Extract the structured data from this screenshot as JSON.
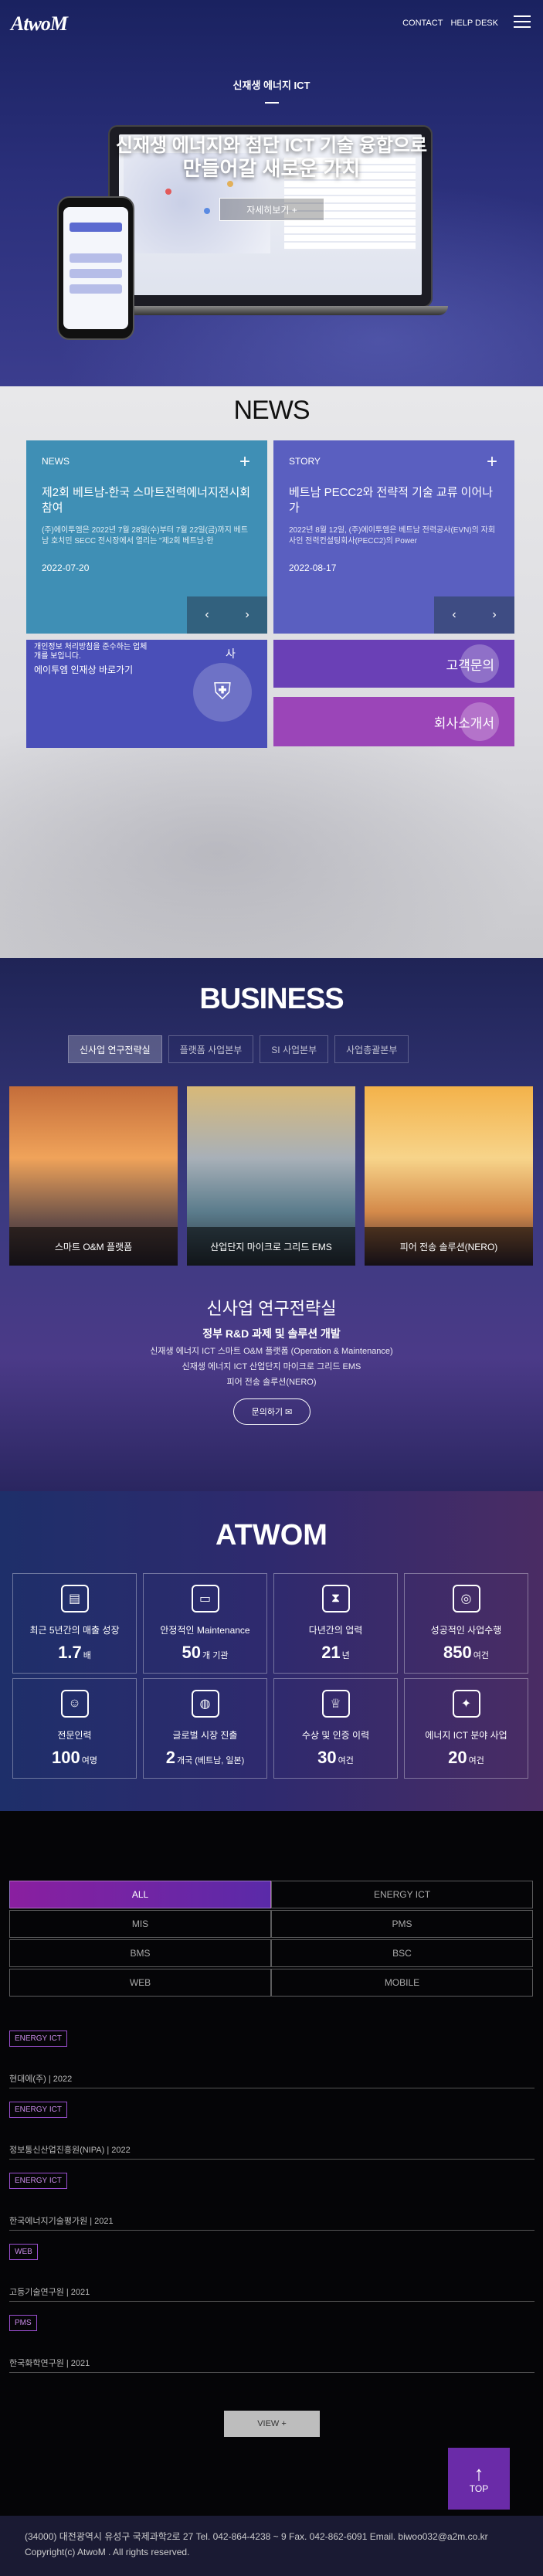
{
  "header": {
    "logo": "AtwoM",
    "nav": [
      "CONTACT",
      "HELP DESK"
    ]
  },
  "hero": {
    "subtitle": "신재생 에너지 ICT",
    "title_line1": "신재생 에너지와 첨단 ICT 기술 융합으로",
    "title_line2": "만들어갈 새로운 가치",
    "button": "자세히보기 +"
  },
  "news": {
    "title": "NEWS",
    "cards": [
      {
        "tag": "NEWS",
        "title": "제2회 베트남-한국 스마트전력에너지전시회 참여",
        "desc": "(주)에이투엠은 2022년 7월 28일(수)부터 7월 22일(금)까지 베트남 호치민 SECC 전시장에서 열리는 \"제2회 베트남-한",
        "date": "2022-07-20"
      },
      {
        "tag": "STORY",
        "title": "베트남 PECC2와 전략적 기술 교류 이어나가",
        "desc": "2022년 8월 12일, (주)에이투엠은 베트남 전력공사(EVN)의 자회사인 전력컨설팅회사(PECC2)의 Power",
        "date": "2022-08-17"
      }
    ],
    "arrows": [
      "‹",
      "›"
    ],
    "popup": {
      "text": "개인정보 처리방침을 준수하는 업체\n개를 보입니다.",
      "link": "에이투엠 인재상 바로가기",
      "tail": "사"
    },
    "contact": "고객문의",
    "brochure": "회사소개서"
  },
  "business": {
    "title": "BUSINESS",
    "tabs": [
      "신사업 연구전략실",
      "플랫폼 사업본부",
      "SI 사업본부",
      "사업총괄본부"
    ],
    "cards": [
      "스마트 O&M 플랫폼",
      "산업단지 마이크로 그리드 EMS",
      "피어 전송 솔루션(NERO)"
    ],
    "heading": "신사업 연구전략실",
    "subheading": "정부 R&D 과제 및 솔루션 개발",
    "lines": [
      "신재생 에너지 ICT 스마트 O&M 플랫폼 (Operation & Maintenance)",
      "신재생 에너지 ICT 산업단지 마이크로 그리드 EMS",
      "피어 전송 솔루션(NERO)"
    ],
    "button": "문의하기 ✉"
  },
  "atwom": {
    "title": "ATWOM",
    "stats": [
      {
        "icon": "chart-icon",
        "label": "최근 5년간의 매출 성장",
        "value": "1.7",
        "unit": "배"
      },
      {
        "icon": "monitor-icon",
        "label": "안정적인 Maintenance",
        "value": "50",
        "unit": "개 기관"
      },
      {
        "icon": "hourglass-icon",
        "label": "다년간의 업력",
        "value": "21",
        "unit": "년"
      },
      {
        "icon": "target-icon",
        "label": "성공적인 사업수행",
        "value": "850",
        "unit": "여건"
      },
      {
        "icon": "people-icon",
        "label": "전문인력",
        "value": "100",
        "unit": "여명"
      },
      {
        "icon": "globe-icon",
        "label": "글로벌 시장 진출",
        "value": "2",
        "unit": "개국 (베트남, 일본)"
      },
      {
        "icon": "trophy-icon",
        "label": "수상 및 인증 이력",
        "value": "30",
        "unit": "여건"
      },
      {
        "icon": "lightbulb-icon",
        "label": "에너지 ICT 분야 사업",
        "value": "20",
        "unit": "여건"
      }
    ]
  },
  "portfolio": {
    "filters": [
      "ALL",
      "ENERGY ICT",
      "MIS",
      "PMS",
      "BMS",
      "BSC",
      "WEB",
      "MOBILE"
    ],
    "items": [
      {
        "tag": "ENERGY ICT",
        "meta": "현대에(주) | 2022"
      },
      {
        "tag": "ENERGY ICT",
        "meta": "정보통신산업진흥원(NIPA) | 2022"
      },
      {
        "tag": "ENERGY ICT",
        "meta": "한국에너지기술평가원 | 2021"
      },
      {
        "tag": "WEB",
        "meta": "고등기술연구원 | 2021"
      },
      {
        "tag": "PMS",
        "meta": "한국화학연구원 | 2021"
      }
    ],
    "more": "VIEW +"
  },
  "top_button": {
    "arrow": "↑",
    "label": "TOP"
  },
  "footer": {
    "address": "(34000) 대전광역시 유성구 국제과학2로 27  Tel. 042-864-4238 ~ 9 Fax. 042-862-6091 Email. biwoo032@a2m.co.kr",
    "copyright": "Copyright(c) AtwoM . All rights reserved."
  }
}
